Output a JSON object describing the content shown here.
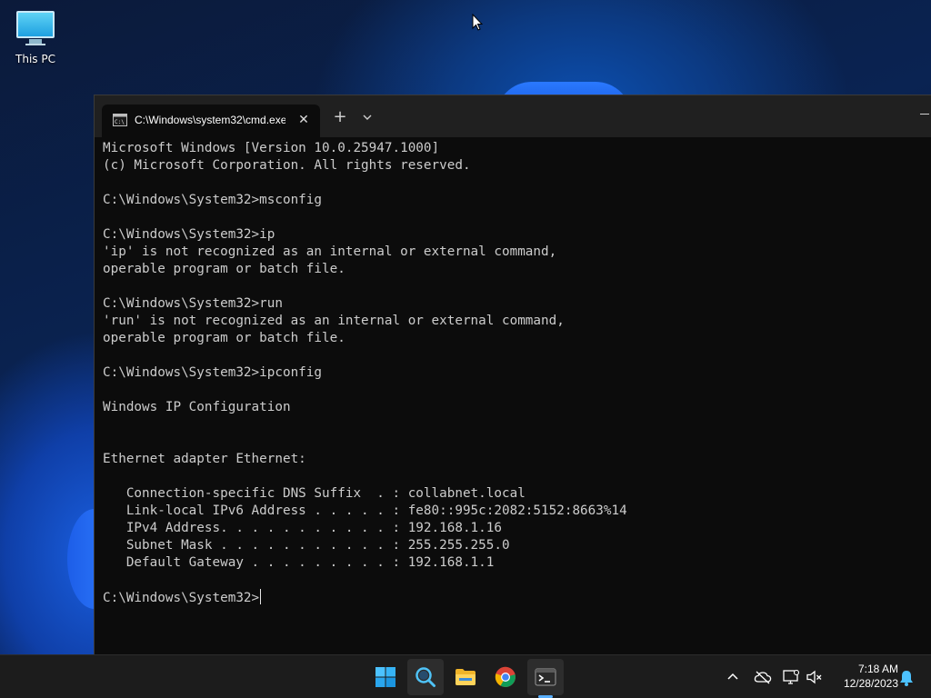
{
  "desktop": {
    "icons": [
      {
        "label": "This PC",
        "icon": "monitor-icon"
      }
    ]
  },
  "terminal": {
    "tab_title": "C:\\Windows\\system32\\cmd.exe",
    "tab_icon": "cmd-icon",
    "new_tab_glyph": "+",
    "close_glyph": "✕",
    "lines": [
      "Microsoft Windows [Version 10.0.25947.1000]",
      "(c) Microsoft Corporation. All rights reserved.",
      "",
      "C:\\Windows\\System32>msconfig",
      "",
      "C:\\Windows\\System32>ip",
      "'ip' is not recognized as an internal or external command,",
      "operable program or batch file.",
      "",
      "C:\\Windows\\System32>run",
      "'run' is not recognized as an internal or external command,",
      "operable program or batch file.",
      "",
      "C:\\Windows\\System32>ipconfig",
      "",
      "Windows IP Configuration",
      "",
      "",
      "Ethernet adapter Ethernet:",
      "",
      "   Connection-specific DNS Suffix  . : collabnet.local",
      "   Link-local IPv6 Address . . . . . : fe80::995c:2082:5152:8663%14",
      "   IPv4 Address. . . . . . . . . . . : 192.168.1.16",
      "   Subnet Mask . . . . . . . . . . . : 255.255.255.0",
      "   Default Gateway . . . . . . . . . : 192.168.1.1",
      ""
    ],
    "prompt": "C:\\Windows\\System32>"
  },
  "taskbar": {
    "apps": [
      {
        "name": "start-button",
        "icon": "windows-logo-icon"
      },
      {
        "name": "search-button",
        "icon": "search-icon"
      },
      {
        "name": "file-explorer-button",
        "icon": "folder-icon"
      },
      {
        "name": "chrome-button",
        "icon": "chrome-icon"
      },
      {
        "name": "terminal-button",
        "icon": "terminal-icon"
      }
    ],
    "tray": {
      "icons": [
        "chevron-up-icon",
        "cloud-offline-icon",
        "network-icon",
        "volume-muted-icon"
      ],
      "time": "7:18 AM",
      "date": "12/28/2023",
      "notification_icon": "bell-icon"
    }
  },
  "colors": {
    "console_bg": "#0c0c0c",
    "console_text": "#cccccc",
    "titlebar_bg": "#202020",
    "taskbar_bg": "#1c1c1c",
    "accent": "#5ab0ff"
  }
}
